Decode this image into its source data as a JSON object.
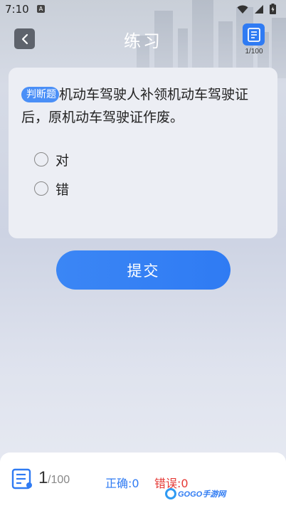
{
  "status_bar": {
    "time": "7:10",
    "indicator": "A",
    "icons": [
      "wifi-icon",
      "signal-icon",
      "battery-icon"
    ]
  },
  "header": {
    "title": "练习",
    "progress": "1/100"
  },
  "question": {
    "type_tag": "判断题",
    "text": "机动车驾驶人补领机动车驾驶证后，原机动车驾驶证作废。",
    "options": [
      {
        "label": "对",
        "selected": false
      },
      {
        "label": "错",
        "selected": false
      }
    ]
  },
  "submit": {
    "label": "提交"
  },
  "bottom_bar": {
    "current": "1",
    "total": "/100",
    "correct": "正确:0",
    "wrong": "错误:0"
  },
  "watermark": {
    "text": "GOGO手游网"
  },
  "colors": {
    "accent": "#2f7bf3",
    "wrong": "#e53935",
    "tag": "#4a8ff7"
  }
}
